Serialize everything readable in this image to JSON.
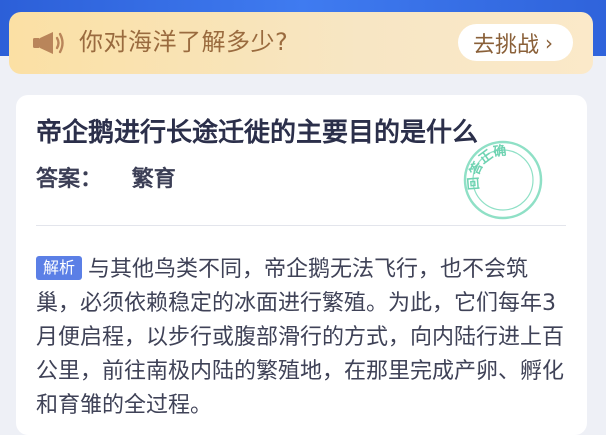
{
  "banner": {
    "icon": "megaphone-icon",
    "text": "你对海洋了解多少?",
    "button_label": "去挑战",
    "button_chevron": "›"
  },
  "question": {
    "title": "帝企鹅进行长途迁徙的主要目的是什么",
    "answer_label": "答案：",
    "answer_value": "繁育",
    "stamp_text": "回答正确"
  },
  "analysis": {
    "tag": "解析",
    "text": "与其他鸟类不同，帝企鹅无法飞行，也不会筑巢，必须依赖稳定的冰面进行繁殖。为此，它们每年3月便启程，以步行或腹部滑行的方式，向内陆行进上百公里，前往南极内陆的繁殖地，在那里完成产卵、孵化和育雏的全过程。"
  },
  "colors": {
    "top_band": "#3f7bf0",
    "banner_bg": "#f7e6c4",
    "banner_text": "#9a6b3f",
    "stamp": "#5fd1ad",
    "tag_bg": "#5b7fe6"
  }
}
